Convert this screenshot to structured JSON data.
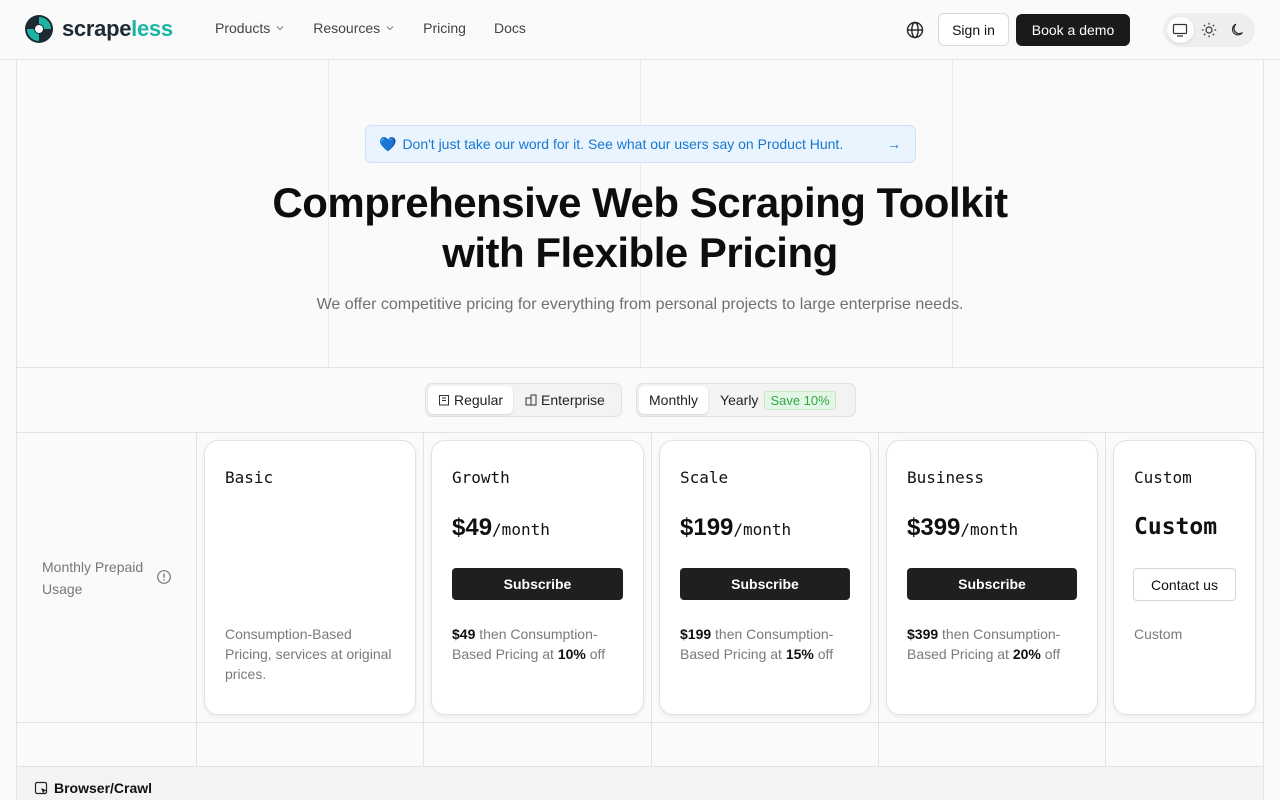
{
  "brand": {
    "name_a": "scrape",
    "name_b": "less",
    "accent": "#1cb5a3"
  },
  "nav": {
    "menu": [
      {
        "label": "Products",
        "dropdown": true
      },
      {
        "label": "Resources",
        "dropdown": true
      },
      {
        "label": "Pricing",
        "dropdown": false
      },
      {
        "label": "Docs",
        "dropdown": false
      }
    ],
    "language_icon": "globe-icon",
    "signin_label": "Sign in",
    "demo_label": "Book a demo",
    "theme": {
      "options": [
        "monitor-icon",
        "sun-icon",
        "moon-icon"
      ],
      "selected": "monitor-icon"
    }
  },
  "hero": {
    "banner_icon": "💙",
    "banner_text": "Don't just take our word for it. See what our users say on Product Hunt.",
    "banner_arrow": "→",
    "title_line1": "Comprehensive Web Scraping Toolkit",
    "title_line2": "with Flexible Pricing",
    "subtitle": "We offer competitive pricing for everything from personal projects to large enterprise needs."
  },
  "toggles": {
    "plan_type": {
      "options": [
        "Regular",
        "Enterprise"
      ],
      "selected": "Regular"
    },
    "billing": {
      "options": [
        "Monthly",
        "Yearly"
      ],
      "selected": "Monthly",
      "yearly_badge": "Save 10%"
    }
  },
  "pricing": {
    "row_label": "Monthly Prepaid Usage",
    "plans": [
      {
        "name": "Basic",
        "price": "",
        "per": "",
        "button": "",
        "desc_plain": "Consumption-Based Pricing, services at original prices."
      },
      {
        "name": "Growth",
        "price": "$49",
        "per": "/month",
        "button": "Subscribe",
        "desc_amount": "$49",
        "desc_mid": " then Consumption-Based Pricing at ",
        "desc_discount": "10%",
        "desc_end": " off"
      },
      {
        "name": "Scale",
        "price": "$199",
        "per": "/month",
        "button": "Subscribe",
        "desc_amount": "$199",
        "desc_mid": " then Consumption-Based Pricing at ",
        "desc_discount": "15%",
        "desc_end": " off"
      },
      {
        "name": "Business",
        "price": "$399",
        "per": "/month",
        "button": "Subscribe",
        "desc_amount": "$399",
        "desc_mid": " then Consumption-Based Pricing at ",
        "desc_discount": "20%",
        "desc_end": " off"
      },
      {
        "name": "Custom",
        "price_custom": "Custom",
        "button": "Contact us",
        "desc_plain": "Custom"
      }
    ]
  },
  "section": {
    "title": "Browser/Crawl",
    "icon": "browser-crawl-icon"
  }
}
